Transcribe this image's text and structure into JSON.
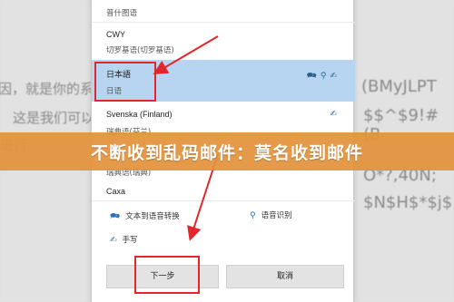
{
  "background": {
    "left_lines": [
      "因，就是你的系",
      "这是我们可以在",
      "进行"
    ],
    "right_lines": [
      "(BMyJLPT",
      "$$^$9!#(B",
      "O*?,40N;",
      "$N$H$*$j$"
    ]
  },
  "dialog": {
    "languages": [
      {
        "name": "",
        "sub": "普什图语"
      },
      {
        "name": "CWY",
        "sub": "切罗基语(切罗基语)"
      },
      {
        "name": "日本語",
        "sub": "日语",
        "selected": true
      },
      {
        "name": "Svenska (Finland)",
        "sub": "瑞典语(芬兰)"
      },
      {
        "name": "",
        "sub": "瑞典语(瑞典)"
      },
      {
        "name": "Caxa",
        "sub": ""
      }
    ],
    "features": {
      "tts": "文本到语音转换",
      "speech": "语音识别",
      "handwriting": "手写"
    },
    "buttons": {
      "next": "下一步",
      "cancel": "取消"
    }
  },
  "banner": {
    "title": "不断收到乱码邮件：莫名收到邮件"
  },
  "colors": {
    "highlight": "#e2262b",
    "selected_row": "#b7d5f0",
    "banner": "#e2923a"
  }
}
